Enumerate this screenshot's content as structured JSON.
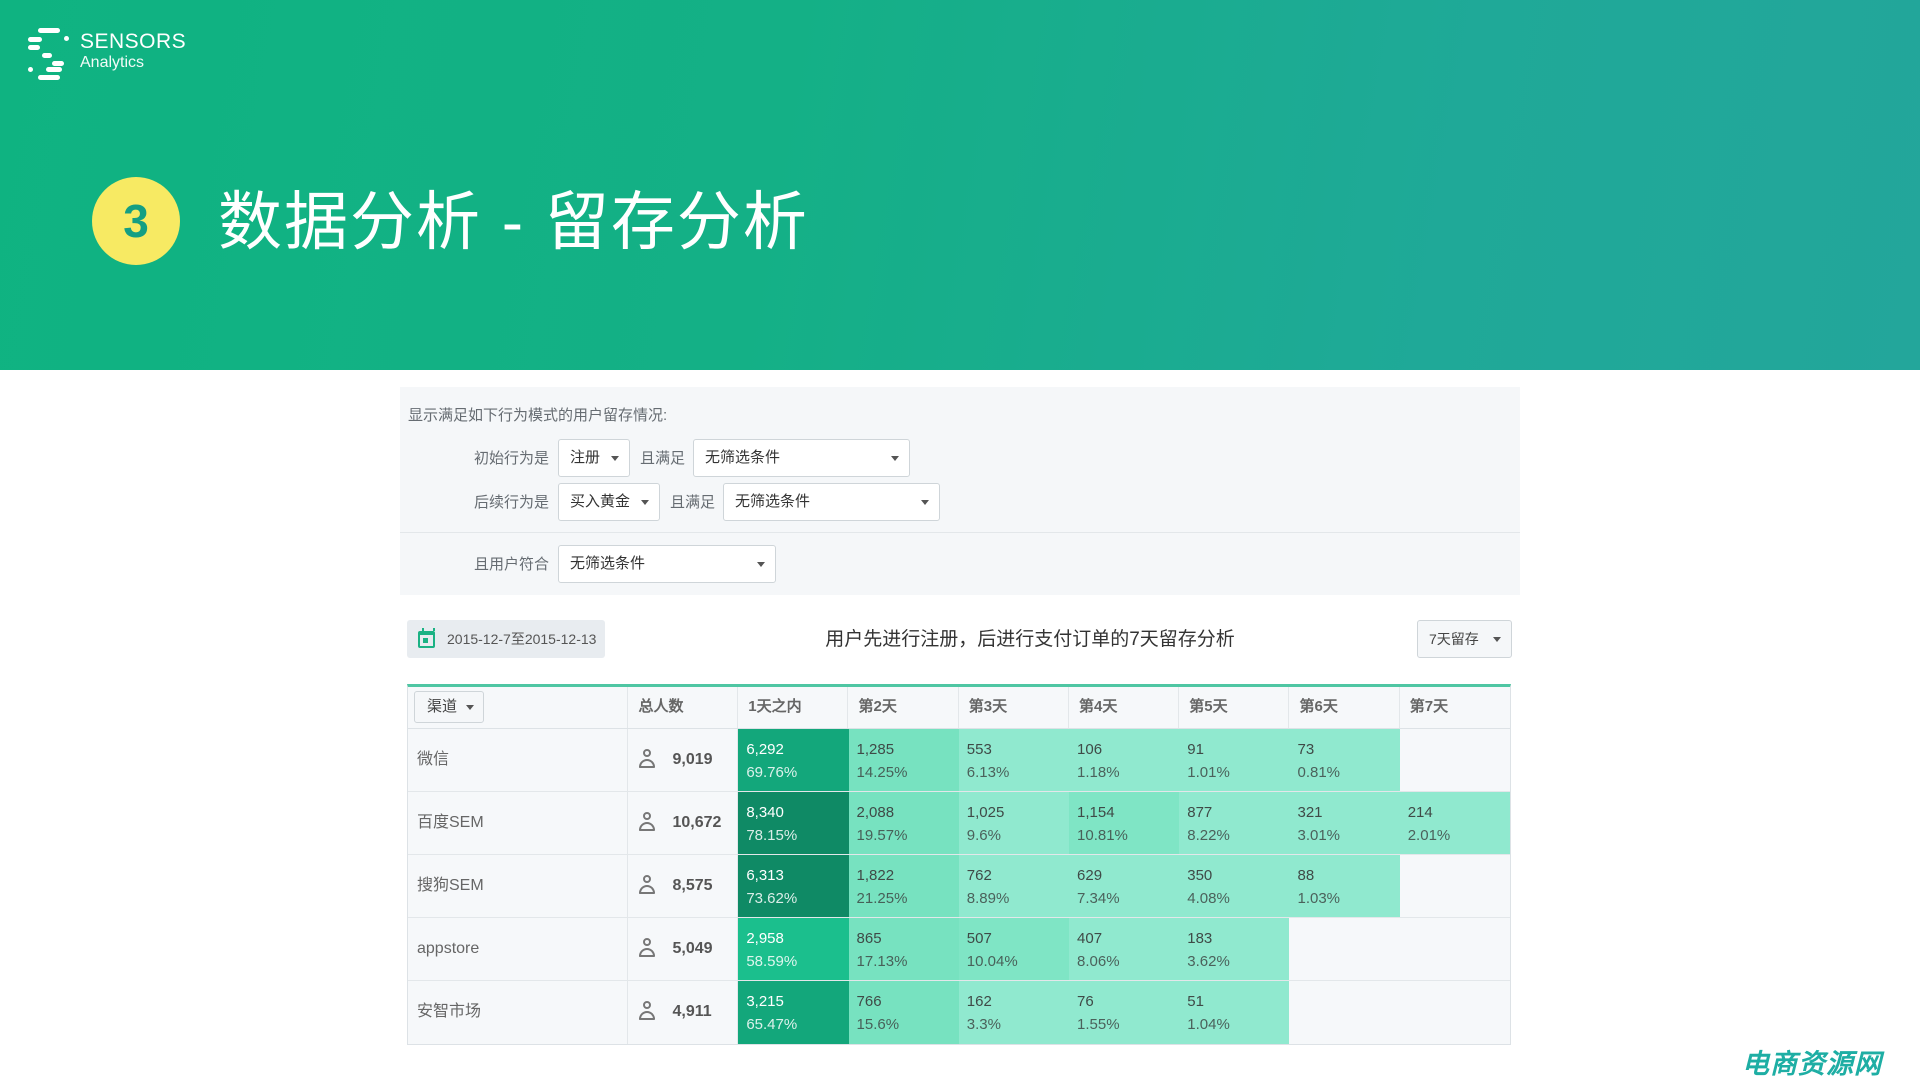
{
  "brand": {
    "name": "SENSORS",
    "sub": "Analytics"
  },
  "hero": {
    "step": "3",
    "title": "数据分析 - 留存分析"
  },
  "filters": {
    "intro": "显示满足如下行为模式的用户留存情况:",
    "initial_label": "初始行为是",
    "initial_value": "注册",
    "initial_cond_label": "且满足",
    "initial_cond_value": "无筛选条件",
    "followup_label": "后续行为是",
    "followup_value": "买入黄金",
    "followup_cond_label": "且满足",
    "followup_cond_value": "无筛选条件",
    "user_label": "且用户符合",
    "user_value": "无筛选条件"
  },
  "toolbar": {
    "date_range": "2015-12-7至2015-12-13",
    "chart_title": "用户先进行注册，后进行支付订单的7天留存分析",
    "period": "7天留存"
  },
  "table": {
    "channel_button": "渠道",
    "headers": [
      "总人数",
      "1天之内",
      "第2天",
      "第3天",
      "第4天",
      "第5天",
      "第6天",
      "第7天"
    ],
    "rows": [
      {
        "channel": "微信",
        "total": "9,019",
        "days": [
          {
            "n": "6,292",
            "p": "69.76%"
          },
          {
            "n": "1,285",
            "p": "14.25%"
          },
          {
            "n": "553",
            "p": "6.13%"
          },
          {
            "n": "106",
            "p": "1.18%"
          },
          {
            "n": "91",
            "p": "1.01%"
          },
          {
            "n": "73",
            "p": "0.81%"
          },
          null
        ]
      },
      {
        "channel": "百度SEM",
        "total": "10,672",
        "days": [
          {
            "n": "8,340",
            "p": "78.15%"
          },
          {
            "n": "2,088",
            "p": "19.57%"
          },
          {
            "n": "1,025",
            "p": "9.6%"
          },
          {
            "n": "1,154",
            "p": "10.81%"
          },
          {
            "n": "877",
            "p": "8.22%"
          },
          {
            "n": "321",
            "p": "3.01%"
          },
          {
            "n": "214",
            "p": "2.01%"
          }
        ]
      },
      {
        "channel": "搜狗SEM",
        "total": "8,575",
        "days": [
          {
            "n": "6,313",
            "p": "73.62%"
          },
          {
            "n": "1,822",
            "p": "21.25%"
          },
          {
            "n": "762",
            "p": "8.89%"
          },
          {
            "n": "629",
            "p": "7.34%"
          },
          {
            "n": "350",
            "p": "4.08%"
          },
          {
            "n": "88",
            "p": "1.03%"
          },
          null
        ]
      },
      {
        "channel": "appstore",
        "total": "5,049",
        "days": [
          {
            "n": "2,958",
            "p": "58.59%"
          },
          {
            "n": "865",
            "p": "17.13%"
          },
          {
            "n": "507",
            "p": "10.04%"
          },
          {
            "n": "407",
            "p": "8.06%"
          },
          {
            "n": "183",
            "p": "3.62%"
          },
          null,
          null
        ]
      },
      {
        "channel": "安智市场",
        "total": "4,911",
        "days": [
          {
            "n": "3,215",
            "p": "65.47%"
          },
          {
            "n": "766",
            "p": "15.6%"
          },
          {
            "n": "162",
            "p": "3.3%"
          },
          {
            "n": "76",
            "p": "1.55%"
          },
          {
            "n": "51",
            "p": "1.04%"
          },
          null,
          null
        ]
      }
    ]
  },
  "colors": {
    "accent": "#1bb284",
    "badge": "#f7ea63",
    "heat_dark": "#0f8a65",
    "heat_mid": "#13a77b",
    "heat_light": "#1bbf8d",
    "heat_pale": "#77e2c0",
    "heat_palest": "#90e9cf"
  },
  "watermark": "电商资源网"
}
